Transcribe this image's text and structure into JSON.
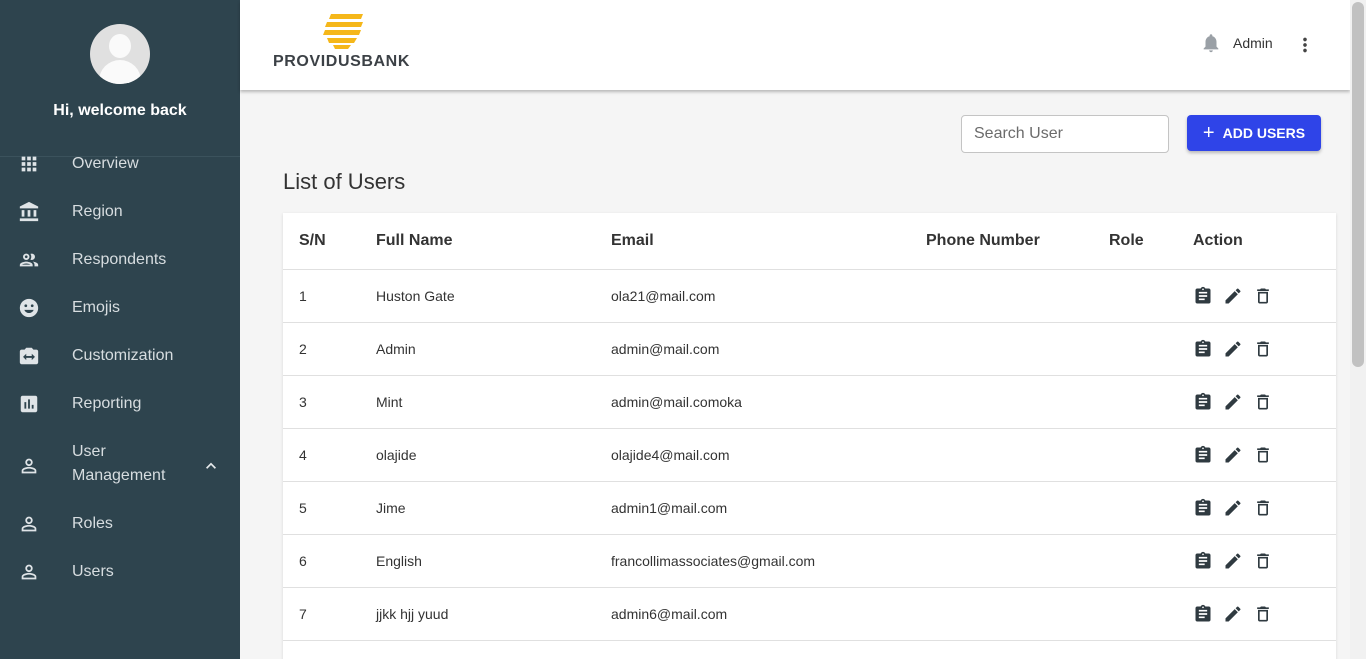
{
  "sidebar": {
    "welcome": "Hi, welcome back",
    "items": [
      {
        "label": "Overview"
      },
      {
        "label": "Region"
      },
      {
        "label": "Respondents"
      },
      {
        "label": "Emojis"
      },
      {
        "label": "Customization"
      },
      {
        "label": "Reporting"
      },
      {
        "label": "User\nManagement"
      },
      {
        "label": "Roles"
      },
      {
        "label": "Users"
      }
    ]
  },
  "header": {
    "logo_text": "PROVIDUSBANK",
    "admin_label": "Admin"
  },
  "main": {
    "search_placeholder": "Search User",
    "add_button_label": "ADD USERS",
    "title": "List of Users"
  },
  "table": {
    "headers": [
      "S/N",
      "Full Name",
      "Email",
      "Phone Number",
      "Role",
      "Action"
    ],
    "rows": [
      {
        "sn": "1",
        "name": "Huston Gate",
        "email": "ola21@mail.com",
        "phone": "",
        "role": ""
      },
      {
        "sn": "2",
        "name": "Admin",
        "email": "admin@mail.com",
        "phone": "",
        "role": ""
      },
      {
        "sn": "3",
        "name": "Mint",
        "email": "admin@mail.comoka",
        "phone": "",
        "role": ""
      },
      {
        "sn": "4",
        "name": "olajide",
        "email": "olajide4@mail.com",
        "phone": "",
        "role": ""
      },
      {
        "sn": "5",
        "name": "Jime",
        "email": "admin1@mail.com",
        "phone": "",
        "role": ""
      },
      {
        "sn": "6",
        "name": "English",
        "email": "francollimassociates@gmail.com",
        "phone": "",
        "role": ""
      },
      {
        "sn": "7",
        "name": "jjkk hjj yuud",
        "email": "admin6@mail.com",
        "phone": "",
        "role": ""
      }
    ]
  },
  "colors": {
    "sidebar_bg": "#2e444e",
    "accent": "#2f44e8",
    "logo_yellow": "#f5b71a"
  }
}
